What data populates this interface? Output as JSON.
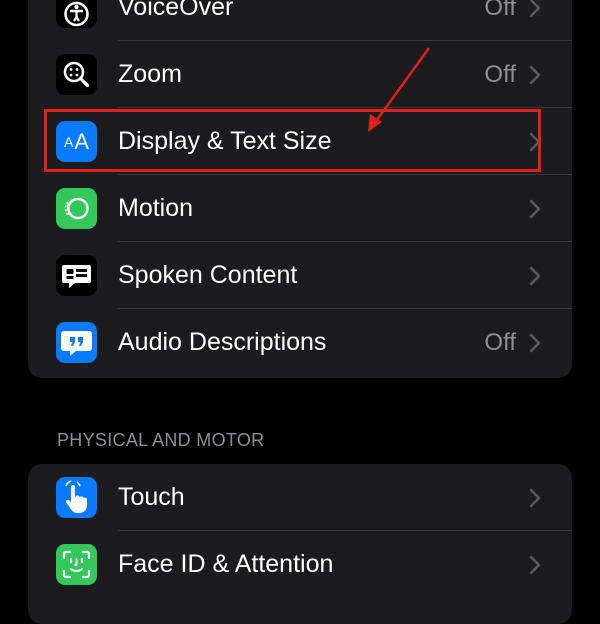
{
  "colors": {
    "background": "#000000",
    "group_background": "#1c1c1e",
    "separator": "#38383a",
    "secondary_text": "#8e8e93",
    "annotation_red": "#e0201b",
    "blue_icon": "#0a7aff",
    "green_icon": "#34c759"
  },
  "vision_group": {
    "rows": [
      {
        "label": "VoiceOver",
        "value": "Off",
        "icon": "voiceover-icon"
      },
      {
        "label": "Zoom",
        "value": "Off",
        "icon": "zoom-icon"
      },
      {
        "label": "Display & Text Size",
        "value": "",
        "icon": "display-text-size-icon",
        "icon_text": "AA"
      },
      {
        "label": "Motion",
        "value": "",
        "icon": "motion-icon"
      },
      {
        "label": "Spoken Content",
        "value": "",
        "icon": "spoken-content-icon"
      },
      {
        "label": "Audio Descriptions",
        "value": "Off",
        "icon": "audio-descriptions-icon"
      }
    ]
  },
  "physical_section": {
    "header": "PHYSICAL AND MOTOR",
    "rows": [
      {
        "label": "Touch",
        "value": "",
        "icon": "touch-icon"
      },
      {
        "label": "Face ID & Attention",
        "value": "",
        "icon": "face-id-icon"
      }
    ]
  },
  "annotation": {
    "highlighted_row": "Display & Text Size",
    "arrow": "arrow-pointing-to-display-text-size"
  }
}
